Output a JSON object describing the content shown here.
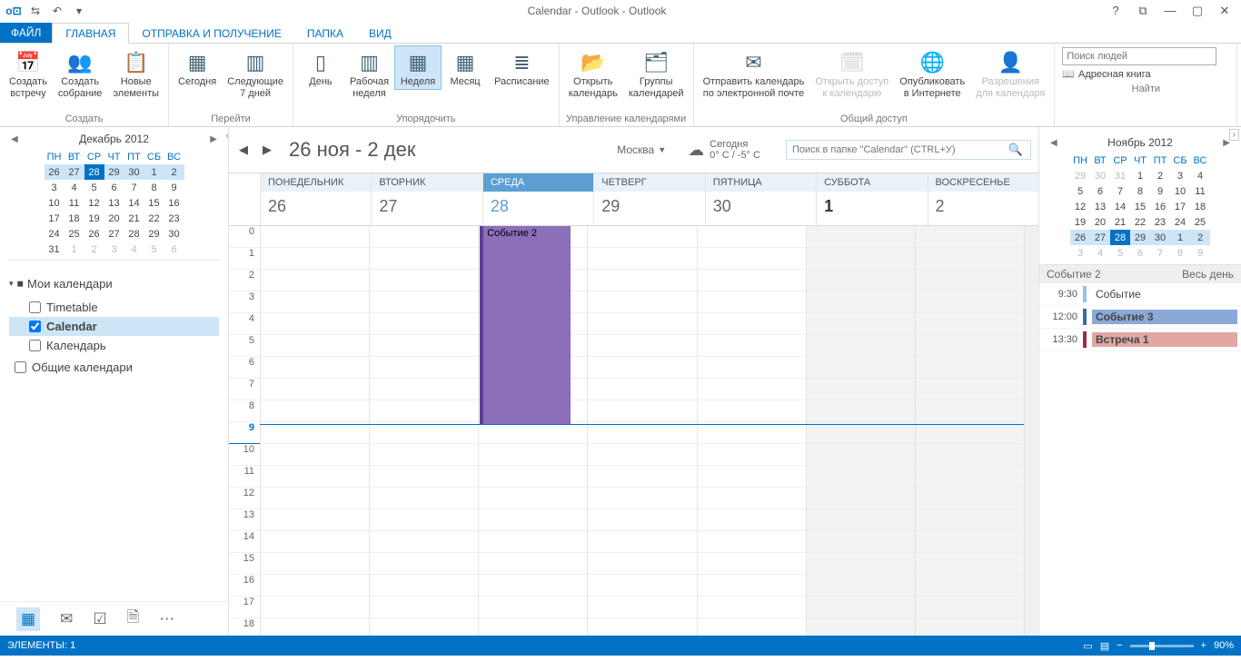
{
  "titlebar": {
    "title": "Calendar - Outlook - Outlook"
  },
  "tabs": {
    "file": "ФАЙЛ",
    "home": "ГЛАВНАЯ",
    "sendrecv": "ОТПРАВКА И ПОЛУЧЕНИЕ",
    "folder": "ПАПКА",
    "view": "ВИД"
  },
  "ribbon": {
    "create_appointment": "Создать\nвстречу",
    "create_meeting": "Создать\nсобрание",
    "new_items": "Новые\nэлементы",
    "group_create": "Создать",
    "today": "Сегодня",
    "next7": "Следующие\n7 дней",
    "group_goto": "Перейти",
    "day": "День",
    "workweek": "Рабочая\nнеделя",
    "week": "Неделя",
    "month": "Месяц",
    "schedule": "Расписание",
    "group_arrange": "Упорядочить",
    "open_cal": "Открыть\nкалендарь",
    "cal_groups": "Группы\nкалендарей",
    "group_manage": "Управление календарями",
    "email_cal": "Отправить календарь\nпо электронной почте",
    "share_cal": "Открыть доступ\nк календарю",
    "publish": "Опубликовать\nв Интернете",
    "permissions": "Разрешения\nдля календаря",
    "group_share": "Общий доступ",
    "search_people_ph": "Поиск людей",
    "address_book": "Адресная книга",
    "group_find": "Найти"
  },
  "left_minical": {
    "title": "Декабрь 2012",
    "dow": [
      "ПН",
      "ВТ",
      "СР",
      "ЧТ",
      "ПТ",
      "СБ",
      "ВС"
    ],
    "weeks": [
      [
        {
          "d": "26",
          "c": "weekhl"
        },
        {
          "d": "27",
          "c": "weekhl"
        },
        {
          "d": "28",
          "c": "today"
        },
        {
          "d": "29",
          "c": "weekhl"
        },
        {
          "d": "30",
          "c": "weekhl"
        },
        {
          "d": "1",
          "c": "weekhl"
        },
        {
          "d": "2",
          "c": "weekhl"
        }
      ],
      [
        {
          "d": "3"
        },
        {
          "d": "4"
        },
        {
          "d": "5"
        },
        {
          "d": "6"
        },
        {
          "d": "7"
        },
        {
          "d": "8"
        },
        {
          "d": "9"
        }
      ],
      [
        {
          "d": "10"
        },
        {
          "d": "11"
        },
        {
          "d": "12"
        },
        {
          "d": "13"
        },
        {
          "d": "14"
        },
        {
          "d": "15"
        },
        {
          "d": "16"
        }
      ],
      [
        {
          "d": "17"
        },
        {
          "d": "18"
        },
        {
          "d": "19"
        },
        {
          "d": "20"
        },
        {
          "d": "21"
        },
        {
          "d": "22"
        },
        {
          "d": "23"
        }
      ],
      [
        {
          "d": "24"
        },
        {
          "d": "25"
        },
        {
          "d": "26"
        },
        {
          "d": "27"
        },
        {
          "d": "28"
        },
        {
          "d": "29"
        },
        {
          "d": "30"
        }
      ],
      [
        {
          "d": "31"
        },
        {
          "d": "1",
          "c": "gray"
        },
        {
          "d": "2",
          "c": "gray"
        },
        {
          "d": "3",
          "c": "gray"
        },
        {
          "d": "4",
          "c": "gray"
        },
        {
          "d": "5",
          "c": "gray"
        },
        {
          "d": "6",
          "c": "gray"
        }
      ]
    ]
  },
  "calendars": {
    "my": "Мои календари",
    "items": [
      {
        "label": "Timetable",
        "checked": false
      },
      {
        "label": "Calendar",
        "checked": true,
        "selected": true
      },
      {
        "label": "Календарь",
        "checked": false
      }
    ],
    "shared": "Общие календари"
  },
  "main": {
    "range": "26 ноя - 2 дек",
    "city": "Москва",
    "weather_top": "Сегодня",
    "weather_bottom": "0° C / -5° C",
    "search_ph": "Поиск в папке \"Calendar\" (CTRL+У)",
    "days": [
      {
        "name": "ПОНЕДЕЛЬНИК",
        "num": "26"
      },
      {
        "name": "ВТОРНИК",
        "num": "27"
      },
      {
        "name": "СРЕДА",
        "num": "28",
        "today": true
      },
      {
        "name": "ЧЕТВЕРГ",
        "num": "29"
      },
      {
        "name": "ПЯТНИЦА",
        "num": "30"
      },
      {
        "name": "СУББОТА",
        "num": "1",
        "sat": true
      },
      {
        "name": "ВОСКРЕСЕНЬЕ",
        "num": "2"
      }
    ],
    "hours": [
      "0",
      "1",
      "2",
      "3",
      "4",
      "5",
      "6",
      "7",
      "8",
      "9",
      "10",
      "11",
      "12",
      "13",
      "14",
      "15",
      "16",
      "17",
      "18"
    ],
    "current_hour_index": 9,
    "event_title": "Событие 2"
  },
  "right_minical": {
    "title": "Ноябрь 2012",
    "dow": [
      "ПН",
      "ВТ",
      "СР",
      "ЧТ",
      "ПТ",
      "СБ",
      "ВС"
    ],
    "weeks": [
      [
        {
          "d": "29",
          "c": "gray"
        },
        {
          "d": "30",
          "c": "gray"
        },
        {
          "d": "31",
          "c": "gray"
        },
        {
          "d": "1"
        },
        {
          "d": "2"
        },
        {
          "d": "3"
        },
        {
          "d": "4"
        }
      ],
      [
        {
          "d": "5"
        },
        {
          "d": "6"
        },
        {
          "d": "7"
        },
        {
          "d": "8"
        },
        {
          "d": "9"
        },
        {
          "d": "10"
        },
        {
          "d": "11"
        }
      ],
      [
        {
          "d": "12"
        },
        {
          "d": "13"
        },
        {
          "d": "14"
        },
        {
          "d": "15"
        },
        {
          "d": "16"
        },
        {
          "d": "17"
        },
        {
          "d": "18"
        }
      ],
      [
        {
          "d": "19"
        },
        {
          "d": "20"
        },
        {
          "d": "21"
        },
        {
          "d": "22"
        },
        {
          "d": "23"
        },
        {
          "d": "24"
        },
        {
          "d": "25"
        }
      ],
      [
        {
          "d": "26",
          "c": "weekhl"
        },
        {
          "d": "27",
          "c": "weekhl"
        },
        {
          "d": "28",
          "c": "today"
        },
        {
          "d": "29",
          "c": "weekhl"
        },
        {
          "d": "30",
          "c": "weekhl"
        },
        {
          "d": "1",
          "c": "weekhl"
        },
        {
          "d": "2",
          "c": "weekhl"
        }
      ],
      [
        {
          "d": "3",
          "c": "gray"
        },
        {
          "d": "4",
          "c": "gray"
        },
        {
          "d": "5",
          "c": "gray"
        },
        {
          "d": "6",
          "c": "gray"
        },
        {
          "d": "7",
          "c": "gray"
        },
        {
          "d": "8",
          "c": "gray"
        },
        {
          "d": "9",
          "c": "gray"
        }
      ]
    ]
  },
  "agenda": {
    "allday_title": "Событие 2",
    "allday_right": "Весь день",
    "rows": [
      {
        "time": "9:30",
        "title": "Событие",
        "cls": "light"
      },
      {
        "time": "12:00",
        "title": "Событие 3",
        "cls": "blue"
      },
      {
        "time": "13:30",
        "title": "Встреча 1",
        "cls": "pink"
      }
    ]
  },
  "statusbar": {
    "items": "ЭЛЕМЕНТЫ: 1",
    "zoom": "90%"
  }
}
